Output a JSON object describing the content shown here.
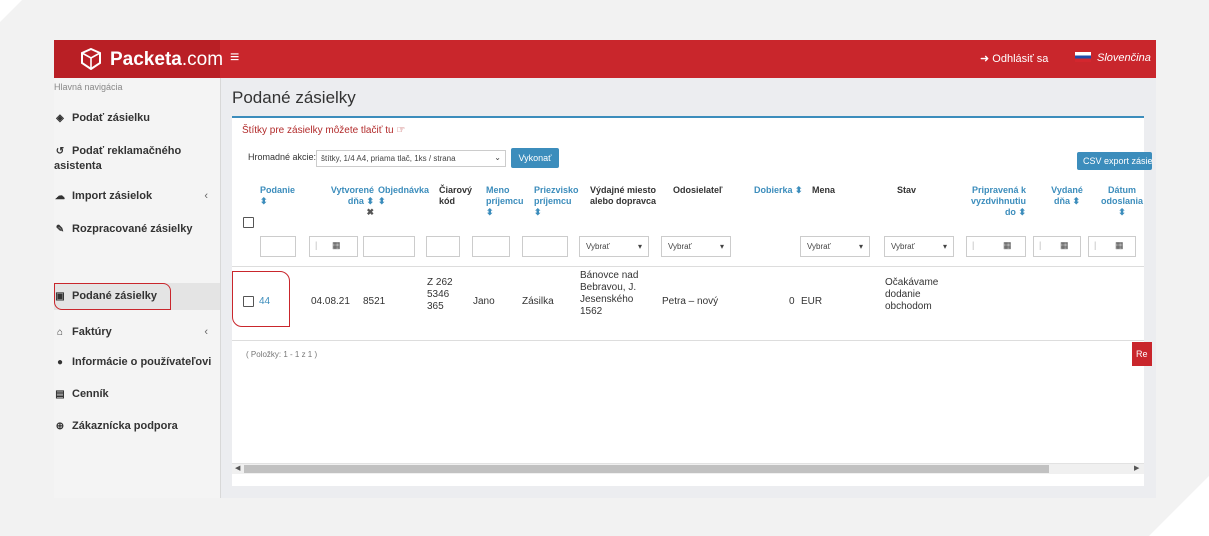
{
  "brand": {
    "name_bold": "Packeta",
    "name_rest": ".com"
  },
  "topbar": {
    "menu_icon": "≡",
    "logout_icon": "➜",
    "logout": "Odhlásiť sa",
    "language": "Slovenčina"
  },
  "sidebar": {
    "heading": "Hlavná navigácia",
    "items": [
      {
        "label": "Podať zásielku",
        "icon": "box-icon"
      },
      {
        "label": "Podať reklamačného asistenta",
        "icon": "undo-icon"
      },
      {
        "label": "Import zásielok",
        "icon": "cloud-upload-icon"
      },
      {
        "label": "Rozpracované zásielky",
        "icon": "edit-icon"
      },
      {
        "label": "Podané zásielky",
        "icon": "archive-icon"
      },
      {
        "label": "Faktúry",
        "icon": "bank-icon"
      },
      {
        "label": "Informácie o používateľovi",
        "icon": "user-icon"
      },
      {
        "label": "Cenník",
        "icon": "money-icon"
      },
      {
        "label": "Zákaznícka podpora",
        "icon": "lifebuoy-icon"
      }
    ]
  },
  "page": {
    "title": "Podané zásielky",
    "print_link": "Štítky pre zásielky môžete tlačiť tu",
    "bulk_label": "Hromadné akcie:",
    "bulk_value": "štítky, 1/4 A4, priama tlač, 1ks / strana",
    "run_button": "Vykonať",
    "csv_button": "CSV export zásielok",
    "pager": "( Položky: 1 - 1 z 1 )",
    "red_button": "Re"
  },
  "table": {
    "headers": {
      "podanie": "Podanie",
      "vytvorene": "Vytvorené dňa",
      "objednavka": "Objednávka",
      "ciarovy": "Čiarový kód",
      "meno": "Meno príjemcu",
      "priezvisko": "Priezvisko príjemcu",
      "vydajne": "Výdajné miesto alebo dopravca",
      "odosielatel": "Odosielateľ",
      "dobierka": "Dobierka",
      "mena": "Mena",
      "stav": "Stav",
      "pripravena": "Pripravená k vyzdvihnutiu do",
      "vydane": "Vydané dňa",
      "datum": "Dátum odoslania"
    },
    "filter_placeholder": "Vybrať",
    "row": {
      "podanie": "44",
      "vytvorene": "04.08.21",
      "objednavka": "8521",
      "ciarovy": "Z 262 5346 365",
      "meno": "Jano",
      "priezvisko": "Zásilka",
      "vydajne": "Bánovce nad Bebravou, J. Jesenského 1562",
      "odosielatel": "Petra – nový",
      "dobierka": "0",
      "mena": "EUR",
      "stav": "Očakávame dodanie obchodom"
    }
  },
  "colors": {
    "brand_red": "#c9262c",
    "accent_blue": "#3c8dbc"
  }
}
